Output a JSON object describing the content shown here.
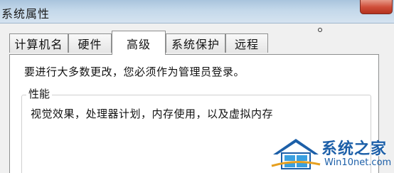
{
  "window": {
    "title": "系统属性"
  },
  "tabs": [
    {
      "label": "计算机名",
      "active": false
    },
    {
      "label": "硬件",
      "active": false
    },
    {
      "label": "高级",
      "active": true
    },
    {
      "label": "系统保护",
      "active": false
    },
    {
      "label": "远程",
      "active": false
    }
  ],
  "advanced": {
    "admin_note": "要进行大多数更改，您必须作为管理员登录。",
    "performance": {
      "title": "性能",
      "description": "视觉效果，处理器计划，内存使用，以及虚拟内存"
    }
  },
  "watermark": {
    "brand": "系统之家",
    "url": "Win10net.com"
  },
  "colors": {
    "titlebar": "#c4d8ea",
    "close_button": "#cf4d39",
    "watermark_blue": "#1c5fa8"
  },
  "icons": [
    "close-icon",
    "system-home-logo-icon"
  ]
}
